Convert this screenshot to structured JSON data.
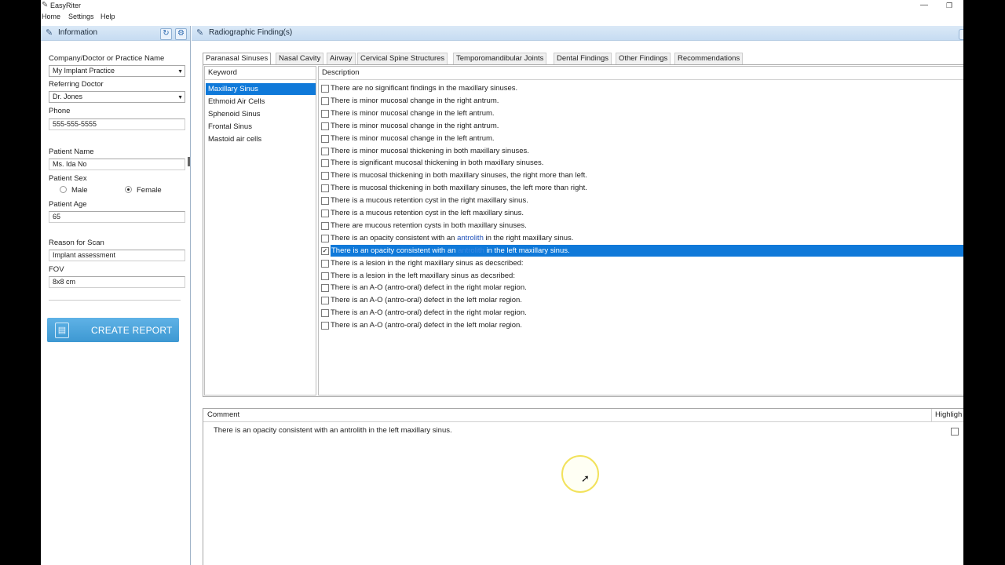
{
  "app": {
    "title": "EasyRiter"
  },
  "menu": [
    "Home",
    "Settings",
    "Help"
  ],
  "info_panel": {
    "title": "Information",
    "company_label": "Company/Doctor or Practice Name",
    "company_value": "My Implant Practice",
    "referring_label": "Referring Doctor",
    "referring_value": "Dr. Jones",
    "phone_label": "Phone",
    "phone_value": "555-555-5555",
    "patient_name_label": "Patient Name",
    "patient_name_value": "Ms. Ida No",
    "sex_label": "Patient Sex",
    "sex_options": [
      "Male",
      "Female"
    ],
    "sex_selected": "Female",
    "age_label": "Patient Age",
    "age_value": "65",
    "reason_label": "Reason for Scan",
    "reason_value": "Implant assessment",
    "fov_label": "FOV",
    "fov_value": "8x8 cm",
    "create_report": "CREATE REPORT"
  },
  "findings_panel": {
    "title": "Radiographic Finding(s)",
    "tabs": [
      "Paranasal Sinuses",
      "Nasal Cavity",
      "Airway",
      "Cervical Spine Structures",
      "Temporomandibular Joints",
      "Dental Findings",
      "Other Findings",
      "Recommendations"
    ],
    "active_tab": "Paranasal Sinuses",
    "keyword_header": "Keyword",
    "keywords": [
      "Maxillary Sinus",
      "Ethmoid Air Cells",
      "Sphenoid Sinus",
      "Frontal Sinus",
      "Mastoid air cells"
    ],
    "selected_keyword": "Maxillary Sinus",
    "description_header": "Description",
    "descriptions": [
      {
        "text": "There are no significant findings in the maxillary sinuses.",
        "checked": false
      },
      {
        "text": "There is minor mucosal change in the right antrum.",
        "checked": false
      },
      {
        "text": "There is minor mucosal change in the left antrum.",
        "checked": false
      },
      {
        "text": "There is minor mucosal change in the right antrum.",
        "checked": false
      },
      {
        "text": "There is minor mucosal change in the left antrum.",
        "checked": false
      },
      {
        "text": "There is minor mucosal thickening in both maxillary sinuses.",
        "checked": false
      },
      {
        "text": "There is significant mucosal thickening in both maxillary sinuses.",
        "checked": false
      },
      {
        "text": "There is mucosal thickening in both maxillary sinuses, the right more than left.",
        "checked": false
      },
      {
        "text": "There is mucosal thickening in both maxillary sinuses, the left more than right.",
        "checked": false
      },
      {
        "text": "There is a mucous retention cyst in the right maxillary sinus.",
        "checked": false
      },
      {
        "text": "There is a mucous retention cyst in the left maxillary sinus.",
        "checked": false
      },
      {
        "text": "There are mucous retention cysts in both maxillary sinuses.",
        "checked": false
      },
      {
        "pre": "There is an opacity consistent with an ",
        "link": "antrolith",
        "post": " in the right maxillary sinus.",
        "checked": false
      },
      {
        "pre": "There is an opacity consistent with an ",
        "link": "antrolith",
        "post": " in the left maxillary sinus.",
        "checked": true,
        "selected": true
      },
      {
        "text": "There is a lesion in the right maxillary sinus as decscribed:",
        "checked": false
      },
      {
        "text": "There is a lesion in the left maxillary sinus as decsribed:",
        "checked": false
      },
      {
        "text": "There is an A-O (antro-oral) defect in the right molar region.",
        "checked": false
      },
      {
        "text": "There is an A-O (antro-oral) defect in the left molar region.",
        "checked": false
      },
      {
        "text": "There is an A-O (antro-oral) defect in the right molar region.",
        "checked": false
      },
      {
        "text": "There is an A-O (antro-oral) defect in the left molar region.",
        "checked": false
      }
    ],
    "comment_header": "Comment",
    "highlight_header": "Highligh",
    "comment_text": "There is an opacity consistent with an antrolith in the left maxillary sinus."
  },
  "colors": {
    "accent": "#0f79d9",
    "button": "#3d98d2",
    "link": "#1d4fb8"
  }
}
